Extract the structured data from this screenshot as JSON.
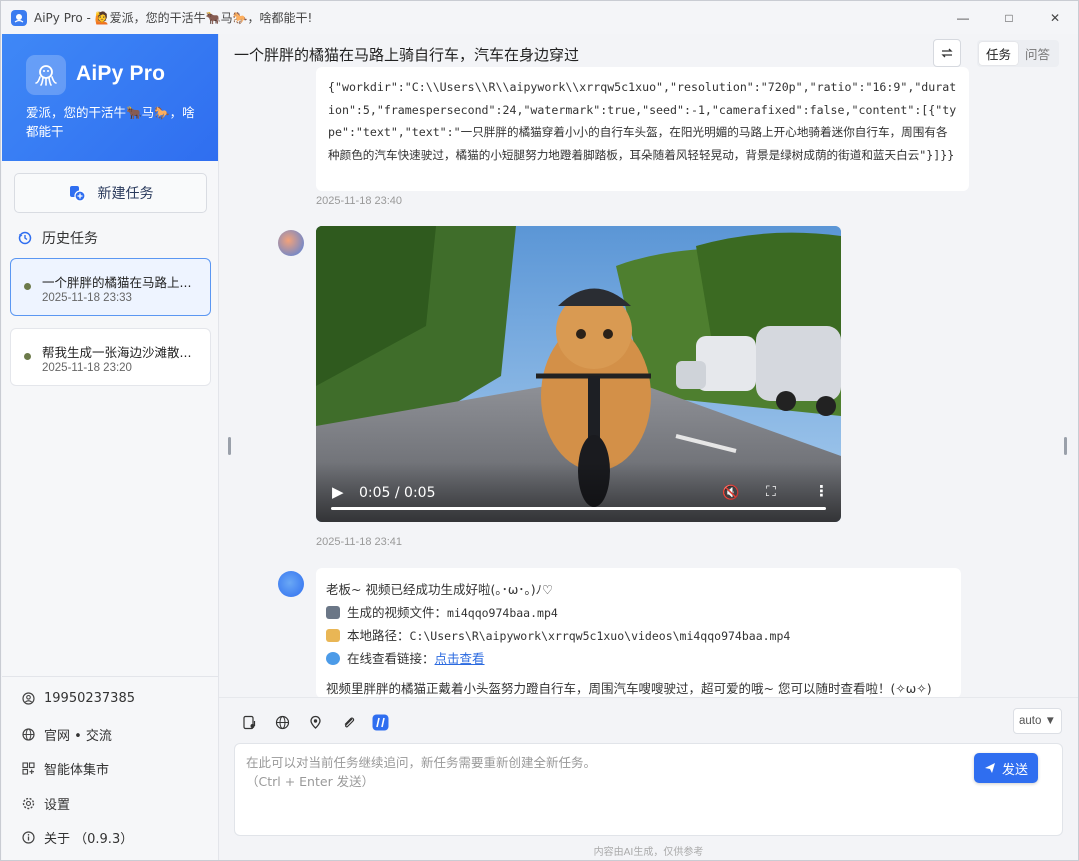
{
  "window": {
    "title": "AiPy Pro - 🙋爱派，您的干活牛🐂马🐎，啥都能干!",
    "min_glyph": "—",
    "max_glyph": "□",
    "close_glyph": "✕"
  },
  "sidebar": {
    "brand_title": "AiPy Pro",
    "brand_subtitle": "爱派，您的干活牛🐂马🐎，啥都能干",
    "new_task_label": "新建任务",
    "history_label": "历史任务",
    "history": [
      {
        "title": "一个胖胖的橘猫在马路上...",
        "time": "2025-11-18 23:33"
      },
      {
        "title": "帮我生成一张海边沙滩散...",
        "time": "2025-11-18 23:20"
      }
    ],
    "bottom": {
      "phone": "19950237385",
      "site": "官网 • 交流",
      "market": "智能体集市",
      "settings": "设置",
      "about": "关于 （0.9.3）"
    }
  },
  "main": {
    "title": "一个胖胖的橘猫在马路上骑自行车，汽车在身边穿过",
    "tabs": [
      "任务",
      "问答"
    ],
    "code_text": "{\"workdir\":\"C:\\\\Users\\\\R\\\\aipywork\\\\xrrqw5c1xuo\",\"resolution\":\"720p\",\"ratio\":\"16:9\",\"duration\":5,\"framespersecond\":24,\"watermark\":true,\"seed\":-1,\"camerafixed\":false,\"content\":[{\"type\":\"text\",\"text\":\"一只胖胖的橘猫穿着小小的自行车头盔，在阳光明媚的马路上开心地骑着迷你自行车，周围有各种颜色的汽车快速驶过，橘猫的小短腿努力地蹬着脚踏板，耳朵随着风轻轻晃动，背景是绿树成荫的街道和蓝天白云\"}]}}",
    "ts1": "2025-11-18 23:40",
    "video_time": "0:05 / 0:05",
    "video_progress": 1.0,
    "ts2": "2025-11-18 23:41",
    "reply": {
      "line1": "老板~ 视频已经成功生成好啦(｡･ω･｡)ﾉ♡",
      "file_label": "生成的视频文件：",
      "file_value": "mi4qqo974baa.mp4",
      "path_label": "本地路径：",
      "path_value": "C:\\Users\\R\\aipywork\\xrrqw5c1xuo\\videos\\mi4qqo974baa.mp4",
      "online_label": "在线查看链接：",
      "online_link": "点击查看",
      "summary": "视频里胖胖的橘猫正戴着小头盔努力蹬自行车，周围汽车嗖嗖驶过，超可爱的哦~ 您可以随时查看啦！(✧ω✧)"
    }
  },
  "composer": {
    "model_select": "auto ▼",
    "placeholder": "在此可以对当前任务继续追问，新任务需要重新创建全新任务。\n（Ctrl + Enter 发送）",
    "send_label": "发送",
    "footer": "内容由AI生成，仅供参考"
  },
  "colors": {
    "accent": "#2f6ef0",
    "brand_gradient_start": "#3f88f6"
  }
}
